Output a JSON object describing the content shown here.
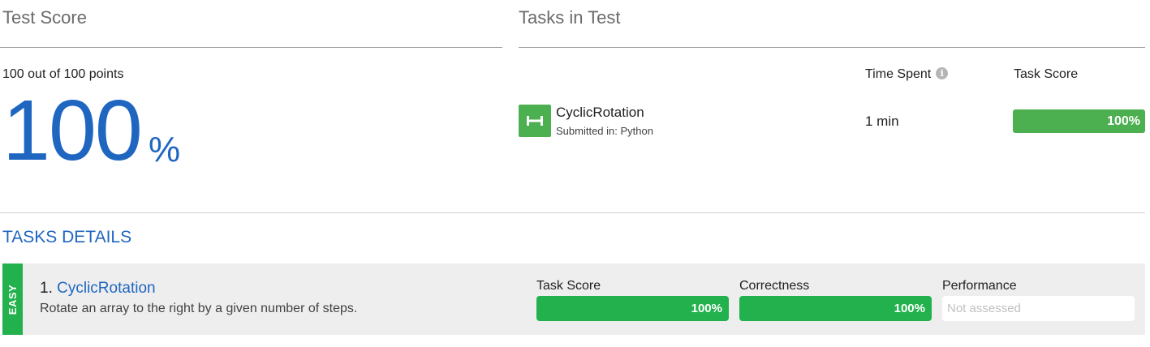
{
  "test_score": {
    "title": "Test Score",
    "points_text": "100 out of 100 points",
    "big_value": "100",
    "big_unit": "%"
  },
  "tasks_in_test": {
    "title": "Tasks in Test",
    "col_time": "Time Spent",
    "col_score": "Task Score",
    "task": {
      "name": "CyclicRotation",
      "submitted": "Submitted in: Python",
      "time": "1 min",
      "score_label": "100%",
      "score_fraction": 1.0,
      "icon": "dumbbell-icon"
    }
  },
  "tasks_details": {
    "title": "TASKS DETAILS",
    "card": {
      "difficulty": "EASY",
      "number": "1.",
      "name": "CyclicRotation",
      "description": "Rotate an array to the right by a given number of steps.",
      "metrics": [
        {
          "label": "Task Score",
          "value": "100%"
        },
        {
          "label": "Correctness",
          "value": "100%"
        },
        {
          "label": "Performance",
          "value": "Not assessed"
        }
      ]
    }
  },
  "colors": {
    "accent_blue": "#1f66c1",
    "success_green": "#22b14c",
    "bar_green": "#4caf50",
    "card_bg": "#eeeeee"
  }
}
